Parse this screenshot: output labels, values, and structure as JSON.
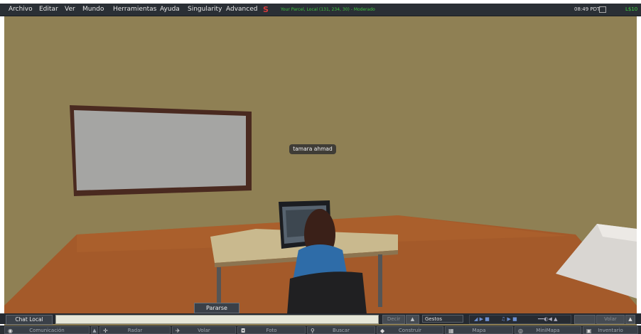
{
  "menu": {
    "items": [
      "Archivo",
      "Editar",
      "Ver",
      "Mundo",
      "Herramientas",
      "Ayuda",
      "Singularity",
      "Advanced"
    ],
    "logo": "S",
    "parcel": "Your Parcel, Local (131, 234, 30) - Moderado",
    "time": "08:49 PDT",
    "balance": "L$10"
  },
  "scene": {
    "avatar_name": "tamara ahmad",
    "stand_button": "Pararse"
  },
  "chat": {
    "channel_button": "Chat Local",
    "input_value": "",
    "say_button": "Decir",
    "gestures_select": "Gestos",
    "fly_button": "Volar"
  },
  "toolbar": {
    "items": [
      {
        "label": "Comunicación",
        "icon": "chat-bubble-icon"
      },
      {
        "label": "Radar",
        "icon": "radar-icon"
      },
      {
        "label": "Volar",
        "icon": "fly-icon"
      },
      {
        "label": "Foto",
        "icon": "camera-icon"
      },
      {
        "label": "Buscar",
        "icon": "search-icon"
      },
      {
        "label": "Construir",
        "icon": "build-icon"
      },
      {
        "label": "Mapa",
        "icon": "map-icon"
      },
      {
        "label": "MiniMapa",
        "icon": "minimap-icon"
      },
      {
        "label": "Inventario",
        "icon": "inventory-icon"
      }
    ]
  },
  "colors": {
    "wall": "#8c7d52",
    "floor": "#a65d2b",
    "menu_bg": "#2a2f35",
    "status_green": "#3fc43f"
  }
}
